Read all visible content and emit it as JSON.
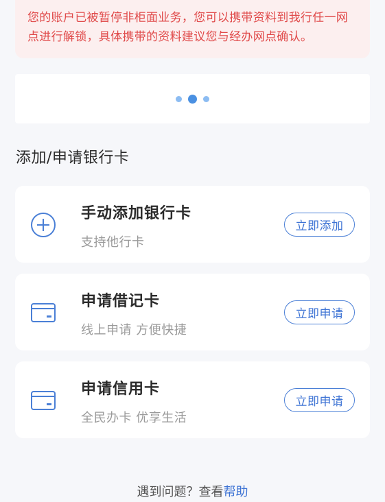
{
  "notice": {
    "text": "您的账户已被暂停非柜面业务，您可以携带资料到我行任一网点进行解锁，具体携带的资料建议您与经办网点确认。"
  },
  "carousel": {
    "active_index": 1,
    "count": 3
  },
  "section": {
    "title": "添加/申请银行卡"
  },
  "cards": [
    {
      "icon": "plus-circle-icon",
      "title": "手动添加银行卡",
      "subtitle": "支持他行卡",
      "button": "立即添加"
    },
    {
      "icon": "card-icon",
      "title": "申请借记卡",
      "subtitle": "线上申请 方便快捷",
      "button": "立即申请"
    },
    {
      "icon": "card-icon",
      "title": "申请信用卡",
      "subtitle": "全民办卡 优享生活",
      "button": "立即申请"
    }
  ],
  "help": {
    "prefix": "遇到问题？查看",
    "link": "帮助"
  },
  "colors": {
    "accent": "#3d73d4",
    "notice_text": "#e04a4a",
    "notice_bg": "#fcefef",
    "page_bg": "#f6f7fa"
  }
}
